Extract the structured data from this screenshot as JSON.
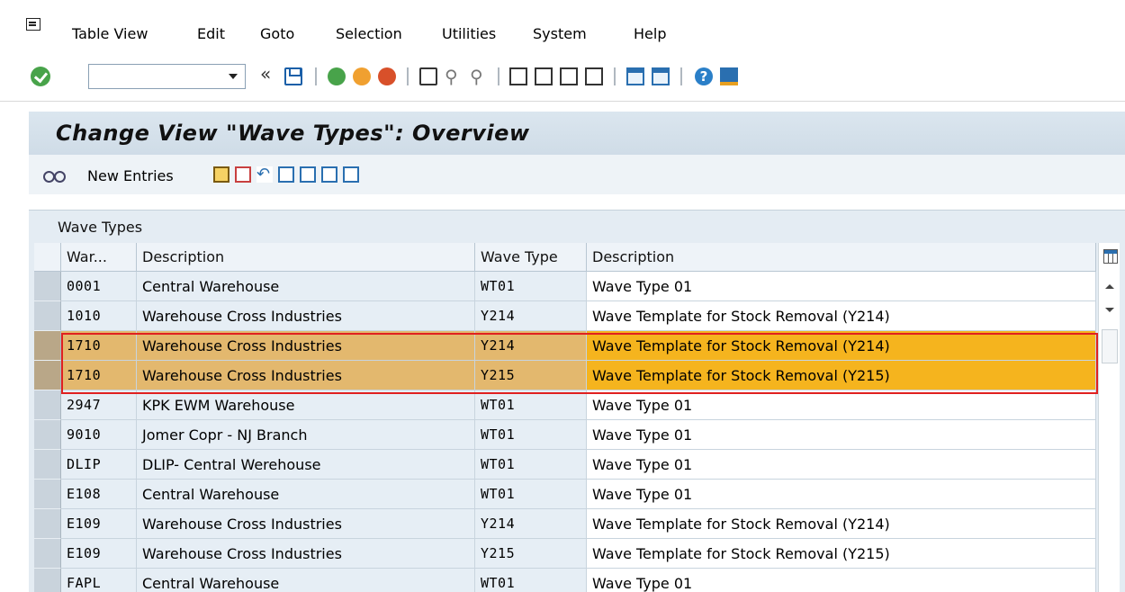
{
  "menu": {
    "items": [
      "Table View",
      "Edit",
      "Goto",
      "Selection",
      "Utilities",
      "System",
      "Help"
    ]
  },
  "toolbar": {
    "command_value": "",
    "icons": [
      "enter-icon",
      "dropdown-arrow-icon",
      "collapse-icon",
      "save-icon",
      "back-icon",
      "exit-icon",
      "cancel-icon",
      "print-icon",
      "find-icon",
      "find-next-icon",
      "first-page-icon",
      "previous-page-icon",
      "next-page-icon",
      "last-page-icon",
      "create-session-icon",
      "shortcut-icon",
      "help-icon",
      "customize-layout-icon"
    ]
  },
  "title": "Change View \"Wave Types\": Overview",
  "app_toolbar": {
    "new_entries_label": "New Entries"
  },
  "table": {
    "title": "Wave Types",
    "headers": [
      "War...",
      "Description",
      "Wave Type",
      "Description"
    ],
    "rows": [
      {
        "warehouse": "0001",
        "wh_desc": "Central Warehouse",
        "wave_type": "WT01",
        "wt_desc": "Wave Type 01",
        "highlighted": false
      },
      {
        "warehouse": "1010",
        "wh_desc": "Warehouse Cross Industries",
        "wave_type": "Y214",
        "wt_desc": "Wave Template for Stock Removal (Y214)",
        "highlighted": false
      },
      {
        "warehouse": "1710",
        "wh_desc": "Warehouse Cross Industries",
        "wave_type": "Y214",
        "wt_desc": "Wave Template for Stock Removal (Y214)",
        "highlighted": true
      },
      {
        "warehouse": "1710",
        "wh_desc": "Warehouse Cross Industries",
        "wave_type": "Y215",
        "wt_desc": "Wave Template for Stock Removal (Y215)",
        "highlighted": true
      },
      {
        "warehouse": "2947",
        "wh_desc": "KPK EWM Warehouse",
        "wave_type": "WT01",
        "wt_desc": "Wave Type 01",
        "highlighted": false
      },
      {
        "warehouse": "9010",
        "wh_desc": "Jomer Copr - NJ Branch",
        "wave_type": "WT01",
        "wt_desc": "Wave Type 01",
        "highlighted": false
      },
      {
        "warehouse": "DLIP",
        "wh_desc": "DLIP- Central Werehouse",
        "wave_type": "WT01",
        "wt_desc": "Wave Type 01",
        "highlighted": false
      },
      {
        "warehouse": "E108",
        "wh_desc": "Central Warehouse",
        "wave_type": "WT01",
        "wt_desc": "Wave Type 01",
        "highlighted": false
      },
      {
        "warehouse": "E109",
        "wh_desc": "Warehouse Cross Industries",
        "wave_type": "Y214",
        "wt_desc": "Wave Template for Stock Removal (Y214)",
        "highlighted": false
      },
      {
        "warehouse": "E109",
        "wh_desc": "Warehouse Cross Industries",
        "wave_type": "Y215",
        "wt_desc": "Wave Template for Stock Removal (Y215)",
        "highlighted": false
      },
      {
        "warehouse": "FAPL",
        "wh_desc": "Central Warehouse",
        "wave_type": "WT01",
        "wt_desc": "Wave Type 01",
        "highlighted": false
      }
    ]
  },
  "colors": {
    "highlight_row": "#e3b86e",
    "highlight_desc": "#f5b41e",
    "highlight_border": "#e02020",
    "title_band": "#d6e2ec"
  }
}
